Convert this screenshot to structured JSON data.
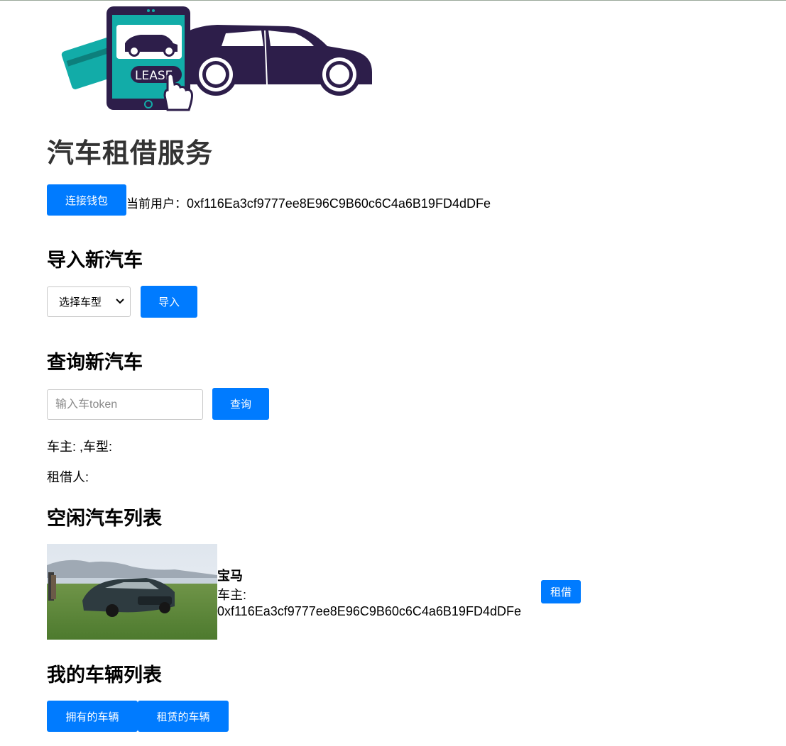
{
  "header": {
    "logo_text": "LEASE",
    "title": "汽车租借服务"
  },
  "wallet": {
    "connect_label": "连接钱包",
    "current_user_label": "当前用户：",
    "current_user_address": "0xf116Ea3cf9777ee8E96C9B60c6C4a6B19FD4dDFe"
  },
  "import_section": {
    "heading": "导入新汽车",
    "select_value": "选择车型",
    "import_label": "导入"
  },
  "query_section": {
    "heading": "查询新汽车",
    "input_placeholder": "输入车token",
    "query_label": "查询",
    "owner_type_line": "车主: ,车型:",
    "renter_line": "租借人:"
  },
  "available_section": {
    "heading": "空闲汽车列表",
    "cars": [
      {
        "name": "宝马",
        "owner_label": "车主:",
        "owner_address": "0xf116Ea3cf9777ee8E96C9B60c6C4a6B19FD4dDFe",
        "rent_label": "租借"
      }
    ]
  },
  "my_section": {
    "heading": "我的车辆列表",
    "owned_label": "拥有的车辆",
    "rented_label": "租赁的车辆"
  },
  "colors": {
    "primary": "#007bff",
    "logo_dark": "#2d1e4a",
    "logo_teal": "#12aca8",
    "heading_dark": "#333333"
  }
}
